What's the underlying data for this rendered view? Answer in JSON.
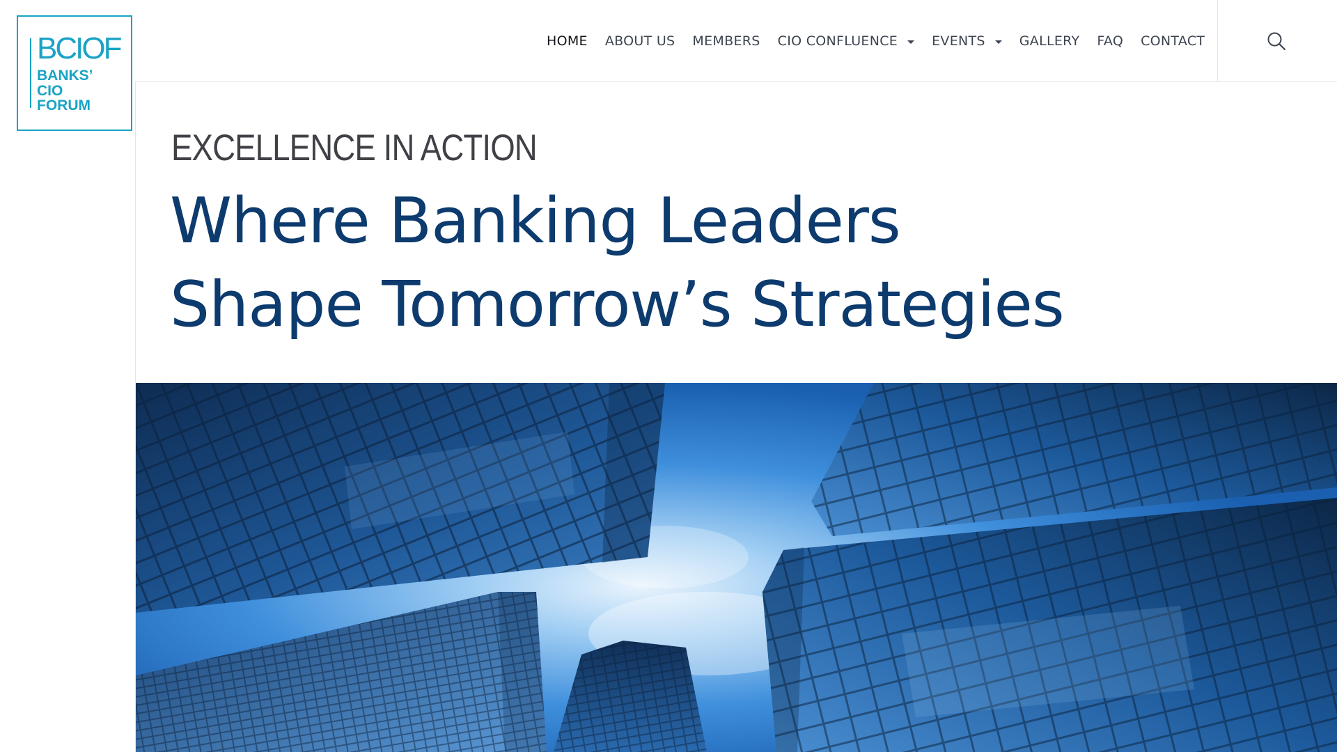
{
  "logo": {
    "acronym": "BCIOF",
    "line1": "BANKS’",
    "line2": "CIO",
    "line3": "FORUM"
  },
  "nav": {
    "items": [
      {
        "label": "HOME",
        "active": true,
        "has_dropdown": false
      },
      {
        "label": "ABOUT US",
        "has_dropdown": false
      },
      {
        "label": "MEMBERS",
        "has_dropdown": false
      },
      {
        "label": "CIO CONFLUENCE",
        "has_dropdown": true
      },
      {
        "label": "EVENTS",
        "has_dropdown": true
      },
      {
        "label": "GALLERY",
        "has_dropdown": false
      },
      {
        "label": "FAQ",
        "has_dropdown": false
      },
      {
        "label": "CONTACT",
        "has_dropdown": false
      }
    ],
    "search_icon": "search-icon"
  },
  "hero": {
    "eyebrow": "EXCELLENCE IN ACTION",
    "headline_line1": "Where Banking Leaders",
    "headline_line2": "Shape Tomorrow’s Strategies",
    "image_subject": "skyscrapers-looking-up"
  },
  "colors": {
    "brand": "#1aa3c4",
    "headline": "#0d3b6e",
    "eyebrow": "#3f4146",
    "nav_text": "#3c4450"
  }
}
